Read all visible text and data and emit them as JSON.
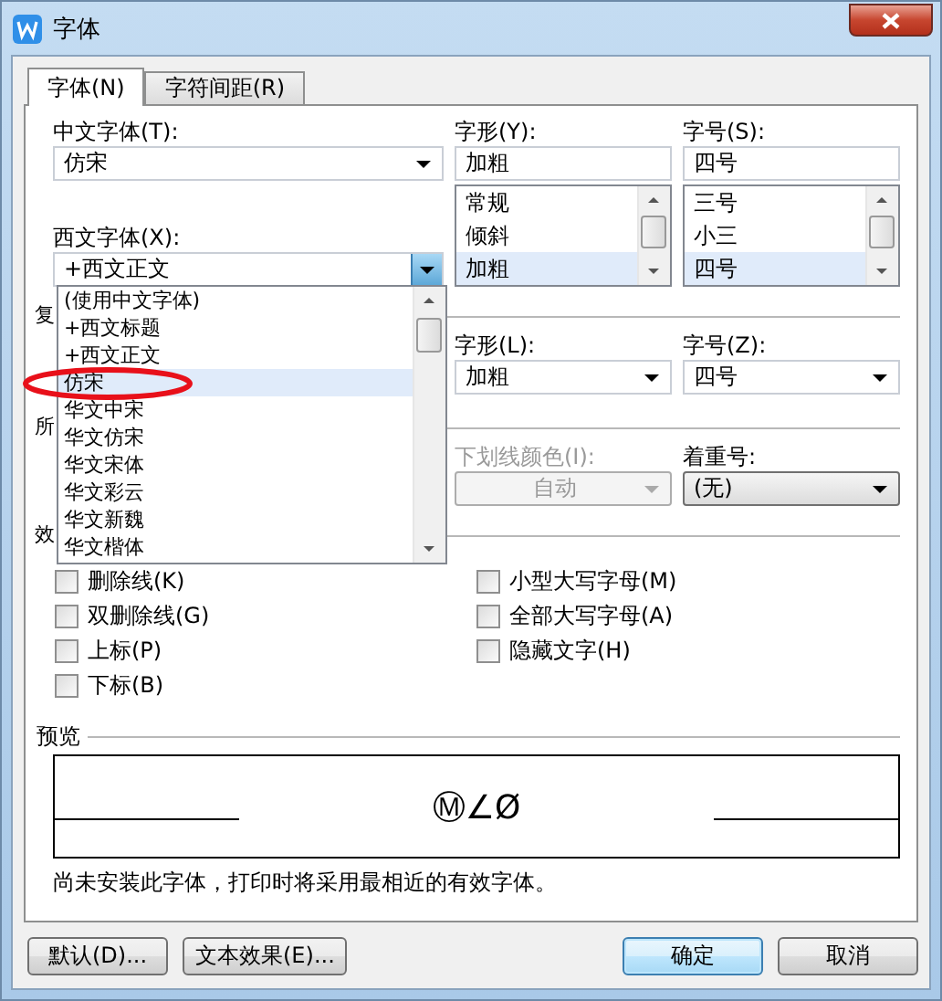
{
  "window": {
    "title": "字体"
  },
  "tabs": [
    {
      "label": "字体(N)",
      "selected": true
    },
    {
      "label": "字符间距(R)",
      "selected": false
    }
  ],
  "chinese_font": {
    "label": "中文字体(T):",
    "value": "仿宋"
  },
  "style": {
    "label": "字形(Y):",
    "value": "加粗",
    "options": [
      {
        "label": "常规",
        "selected": false
      },
      {
        "label": "倾斜",
        "selected": false
      },
      {
        "label": "加粗",
        "selected": true
      }
    ]
  },
  "size": {
    "label": "字号(S):",
    "value": "四号",
    "options": [
      {
        "label": "三号",
        "selected": false
      },
      {
        "label": "小三",
        "selected": false
      },
      {
        "label": "四号",
        "selected": true
      }
    ]
  },
  "western_font": {
    "label": "西文字体(X):",
    "value": "+西文正文",
    "open": true
  },
  "font_list": [
    {
      "label": "(使用中文字体)",
      "selected": false
    },
    {
      "label": "+西文标题",
      "selected": false
    },
    {
      "label": "+西文正文",
      "selected": false
    },
    {
      "label": "仿宋",
      "selected": true
    },
    {
      "label": "华文中宋",
      "selected": false
    },
    {
      "label": "华文仿宋",
      "selected": false
    },
    {
      "label": "华文宋体",
      "selected": false
    },
    {
      "label": "华文彩云",
      "selected": false
    },
    {
      "label": "华文新魏",
      "selected": false
    },
    {
      "label": "华文楷体",
      "selected": false
    }
  ],
  "complex_section": {
    "label": "复"
  },
  "complex_style": {
    "label": "字形(L):",
    "value": "加粗"
  },
  "complex_size": {
    "label": "字号(Z):",
    "value": "四号"
  },
  "all_text_section": {
    "label": "所"
  },
  "underline_color": {
    "label": "下划线颜色(I):",
    "value": "自动",
    "disabled": true
  },
  "emphasis": {
    "label": "着重号:",
    "value": "(无)",
    "disabled": false
  },
  "effects_section": {
    "label": "效"
  },
  "effects": [
    {
      "label": "删除线(K)",
      "checked": false
    },
    {
      "label": "双删除线(G)",
      "checked": false
    },
    {
      "label": "上标(P)",
      "checked": false
    },
    {
      "label": "下标(B)",
      "checked": false
    },
    {
      "label": "小型大写字母(M)",
      "checked": false
    },
    {
      "label": "全部大写字母(A)",
      "checked": false
    },
    {
      "label": "隐藏文字(H)",
      "checked": false
    }
  ],
  "preview": {
    "label": "预览",
    "text": "Ⓜ∠Ø"
  },
  "note": "尚未安装此字体，打印时将采用最相近的有效字体。",
  "buttons_left": [
    {
      "label": "默认(D)...",
      "kind": "plain"
    },
    {
      "label": "文本效果(E)...",
      "kind": "plain"
    }
  ],
  "buttons_right": [
    {
      "label": "确定",
      "kind": "default"
    },
    {
      "label": "取消",
      "kind": "plain"
    }
  ]
}
